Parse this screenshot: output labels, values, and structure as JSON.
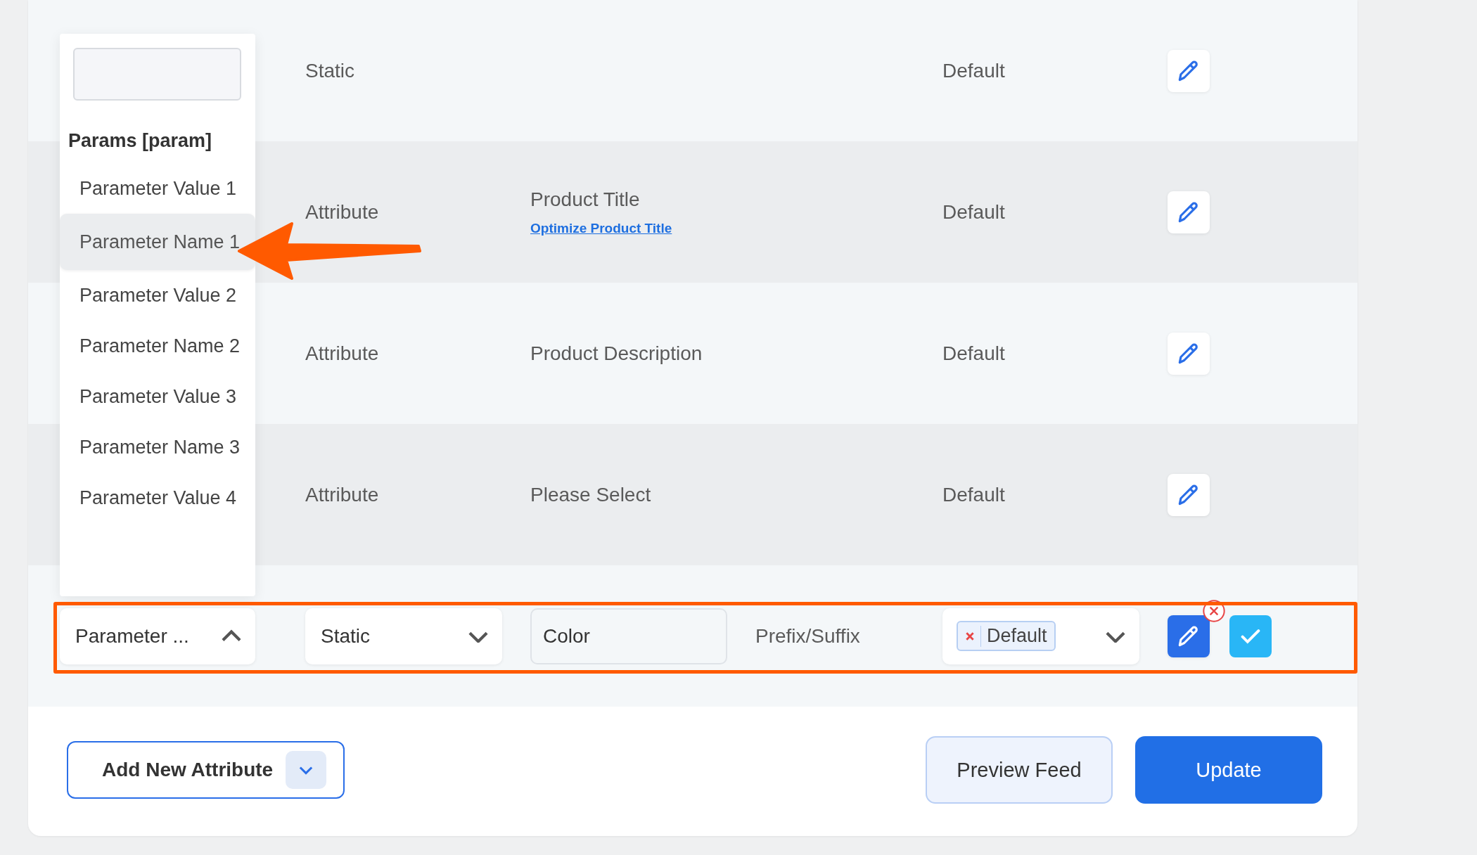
{
  "rows": [
    {
      "type": "Static",
      "prefix": "Default"
    },
    {
      "type": "Attribute",
      "value": "Product Title",
      "link": "Optimize Product Title",
      "prefix": "Default"
    },
    {
      "type": "Attribute",
      "value": "Product Description",
      "prefix": "Default"
    },
    {
      "type": "Attribute",
      "value": "Please Select",
      "prefix": "Default"
    }
  ],
  "dropdown": {
    "group": "Params [param]",
    "options": [
      {
        "label": "Parameter Value 1",
        "selected": false
      },
      {
        "label": "Parameter Name 1",
        "selected": true
      },
      {
        "label": "Parameter Value 2",
        "selected": false
      },
      {
        "label": "Parameter Name 2",
        "selected": false
      },
      {
        "label": "Parameter Value 3",
        "selected": false
      },
      {
        "label": "Parameter Name 3",
        "selected": false
      },
      {
        "label": "Parameter Value 4",
        "selected": false
      }
    ]
  },
  "edit_row": {
    "name_select": {
      "value": "Parameter ...",
      "expanded": true
    },
    "type_select": {
      "value": "Static",
      "expanded": false
    },
    "value_field": {
      "value": "Color"
    },
    "prefix_suffix": "Prefix/Suffix",
    "default_select": {
      "tags": [
        "Default"
      ],
      "expanded": false
    }
  },
  "footer": {
    "add_button": "Add New Attribute",
    "preview_button": "Preview Feed",
    "update_button": "Update"
  }
}
